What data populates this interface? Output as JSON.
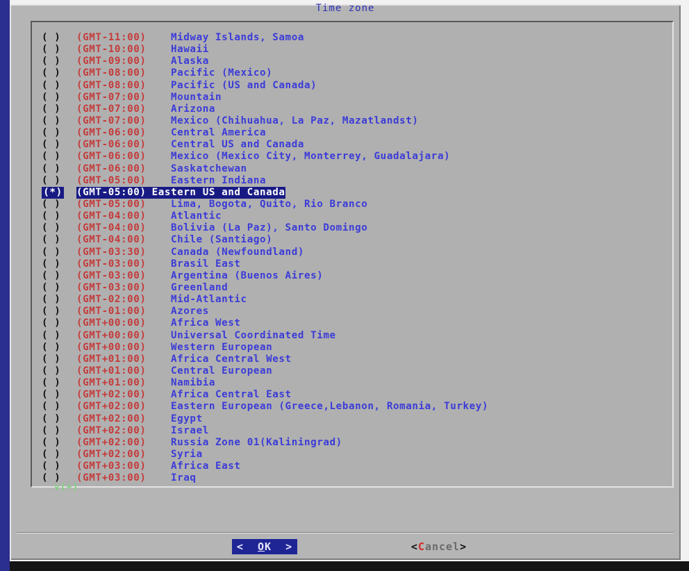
{
  "dialog": {
    "title": "Time zone"
  },
  "timezones": [
    {
      "offset": "(GMT-11:00)",
      "name": "Midway Islands, Samoa"
    },
    {
      "offset": "(GMT-10:00)",
      "name": "Hawaii"
    },
    {
      "offset": "(GMT-09:00)",
      "name": "Alaska"
    },
    {
      "offset": "(GMT-08:00)",
      "name": "Pacific (Mexico)"
    },
    {
      "offset": "(GMT-08:00)",
      "name": "Pacific (US and Canada)"
    },
    {
      "offset": "(GMT-07:00)",
      "name": "Mountain"
    },
    {
      "offset": "(GMT-07:00)",
      "name": "Arizona"
    },
    {
      "offset": "(GMT-07:00)",
      "name": "Mexico (Chihuahua, La Paz, Mazatlandst)"
    },
    {
      "offset": "(GMT-06:00)",
      "name": "Central America"
    },
    {
      "offset": "(GMT-06:00)",
      "name": "Central US and Canada"
    },
    {
      "offset": "(GMT-06:00)",
      "name": "Mexico (Mexico City, Monterrey, Guadalajara)"
    },
    {
      "offset": "(GMT-06:00)",
      "name": "Saskatchewan"
    },
    {
      "offset": "(GMT-05:00)",
      "name": "Eastern Indiana"
    },
    {
      "offset": "(GMT-05:00)",
      "name": "Eastern US and Canada",
      "selected": true
    },
    {
      "offset": "(GMT-05:00)",
      "name": "Lima, Bogota, Quito, Rio Branco"
    },
    {
      "offset": "(GMT-04:00)",
      "name": "Atlantic"
    },
    {
      "offset": "(GMT-04:00)",
      "name": "Bolivia (La Paz), Santo Domingo"
    },
    {
      "offset": "(GMT-04:00)",
      "name": "Chile (Santiago)"
    },
    {
      "offset": "(GMT-03:30)",
      "name": "Canada (Newfoundland)"
    },
    {
      "offset": "(GMT-03:00)",
      "name": "Brasil East"
    },
    {
      "offset": "(GMT-03:00)",
      "name": "Argentina (Buenos Aires)"
    },
    {
      "offset": "(GMT-03:00)",
      "name": "Greenland"
    },
    {
      "offset": "(GMT-02:00)",
      "name": "Mid-Atlantic"
    },
    {
      "offset": "(GMT-01:00)",
      "name": "Azores"
    },
    {
      "offset": "(GMT+00:00)",
      "name": "Africa West"
    },
    {
      "offset": "(GMT+00:00)",
      "name": "Universal Coordinated Time"
    },
    {
      "offset": "(GMT+00:00)",
      "name": "Western European"
    },
    {
      "offset": "(GMT+01:00)",
      "name": "Africa Central West"
    },
    {
      "offset": "(GMT+01:00)",
      "name": "Central European"
    },
    {
      "offset": "(GMT+01:00)",
      "name": "Namibia"
    },
    {
      "offset": "(GMT+02:00)",
      "name": "Africa Central East"
    },
    {
      "offset": "(GMT+02:00)",
      "name": "Eastern European (Greece,Lebanon, Romania, Turkey)"
    },
    {
      "offset": "(GMT+02:00)",
      "name": "Egypt"
    },
    {
      "offset": "(GMT+02:00)",
      "name": "Israel"
    },
    {
      "offset": "(GMT+02:00)",
      "name": "Russia Zone 01(Kaliningrad)"
    },
    {
      "offset": "(GMT+02:00)",
      "name": "Syria"
    },
    {
      "offset": "(GMT+03:00)",
      "name": "Africa East"
    },
    {
      "offset": "(GMT+03:00)",
      "name": "Iraq"
    }
  ],
  "radio": {
    "unselected": "( )",
    "selected": "(*)"
  },
  "scroll_indicator": "v(+)",
  "buttons": {
    "ok": {
      "left": "<",
      "key": "O",
      "rest": "K",
      "right": ">"
    },
    "cancel": {
      "open": "<",
      "hotkey": "C",
      "rest": "ancel",
      "close": ">"
    }
  },
  "colors": {
    "dialog_bg": "#b5b5b5",
    "item_text": "#3b3bd8",
    "offset_text": "#c53b3b",
    "selection_bg": "#181a84",
    "accent_bar": "#2b2f8f"
  }
}
